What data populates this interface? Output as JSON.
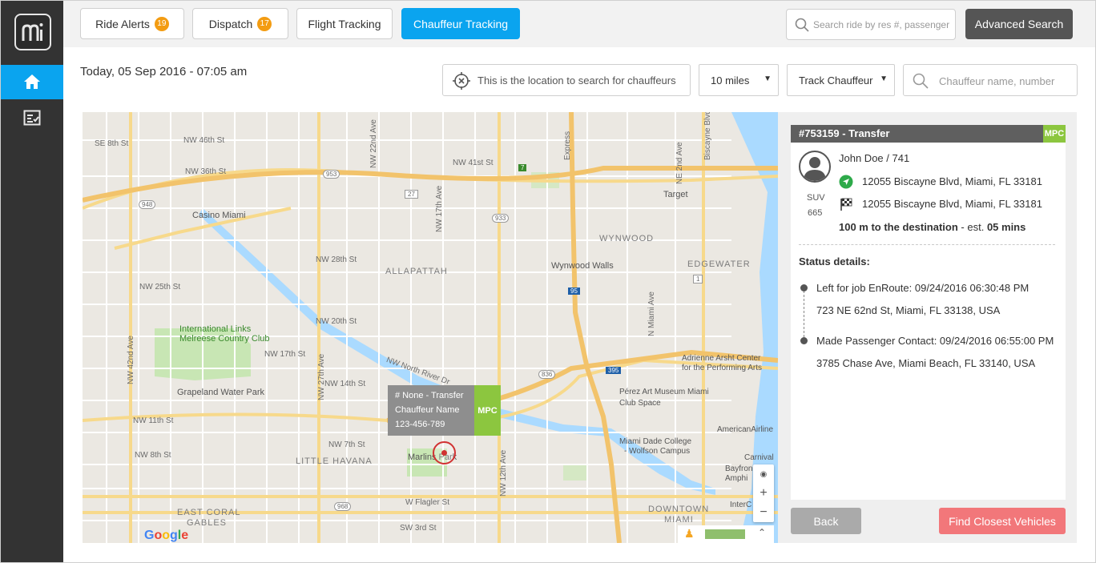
{
  "tabs": [
    {
      "label": "Ride Alerts",
      "badge": "19"
    },
    {
      "label": "Dispatch",
      "badge": "17"
    },
    {
      "label": "Flight Tracking"
    },
    {
      "label": "Chauffeur Tracking"
    }
  ],
  "top_search": {
    "placeholder": "Search ride by res #, passenger"
  },
  "advanced_search_label": "Advanced Search",
  "date_text": "Today, 05 Sep 2016 - 07:05 am",
  "filters": {
    "location_text": "This is the location to search for chauffeurs",
    "radius": "10 miles",
    "track_mode": "Track Chauffeur",
    "chauffeur_placeholder": "Chauffeur name, number"
  },
  "map": {
    "districts": [
      "ALLAPATTAH",
      "WYNWOOD",
      "EDGEWATER",
      "LITTLE HAVANA",
      "EAST CORAL",
      "GABLES",
      "DOWNTOWN",
      "MIAMI"
    ],
    "pois": [
      "Casino Miami",
      "Target",
      "Wynwood Walls",
      "Adrienne Arsht Center",
      "for the Performing Arts",
      "Pérez Art Museum Miami",
      "Club Space",
      "Miami Dade College",
      "- Wolfson Campus",
      "AmericanAirline",
      "Carnival",
      "Bayfron",
      "Amphi",
      "InterC",
      "Grapeland Water Park",
      "Marlins Park"
    ],
    "parks": [
      "International Links",
      "Melreese Country Club"
    ],
    "streets": [
      "NW 46th St",
      "NW 41st St",
      "NW 36th St",
      "NW 28th St",
      "NW 25th St",
      "NW 20th St",
      "NW 17th St",
      "NW 14th St",
      "NW 11th St",
      "NW 7th St",
      "W Flagler St",
      "SW 3rd St",
      "NW North River Dr",
      "NW 27th Ave",
      "NW 17th Ave",
      "NW 12th Ave",
      "NW 42nd Ave",
      "NW 22nd Ave",
      "N Miami Ave",
      "NE 2nd Ave",
      "Biscayne Blvd",
      "Express",
      "SE 8th St",
      "NW 8th St"
    ],
    "highway_shields": [
      "948",
      "933",
      "836",
      "968",
      "953",
      "395",
      "27",
      "95",
      "1",
      "7"
    ],
    "google_text": "Google",
    "zoom_in": "+",
    "zoom_out": "−",
    "popup": {
      "title": "# None - Transfer",
      "name": "Chauffeur Name",
      "phone": "123-456-789",
      "tag": "MPC"
    }
  },
  "ride": {
    "header": "#753159 - Transfer",
    "tag": "MPC",
    "passenger": "John Doe /  741",
    "pickup": "12055 Biscayne Blvd, Miami, FL 33181",
    "dropoff": "12055 Biscayne Blvd, Miami, FL 33181",
    "vehicle_type": "SUV",
    "vehicle_number": "665",
    "distance": "100 m to the destination",
    "eta_label": " - est. ",
    "eta_value": "05 mins",
    "status_title": "Status details:",
    "status": [
      {
        "line1": "Left for job EnRoute: 09/24/2016 06:30:48 PM",
        "line2": "723 NE 62nd St, Miami, FL 33138, USA"
      },
      {
        "line1": "Made Passenger Contact: 09/24/2016 06:55:00 PM",
        "line2": "3785 Chase Ave, Miami Beach, FL 33140, USA"
      }
    ]
  },
  "buttons": {
    "back": "Back",
    "find": "Find Closest Vehicles"
  },
  "colors": {
    "accent": "#0aa4ef",
    "badge": "#f39c12",
    "mpc": "#8cc63f",
    "find": "#f2777a",
    "sidebar": "#333333"
  }
}
